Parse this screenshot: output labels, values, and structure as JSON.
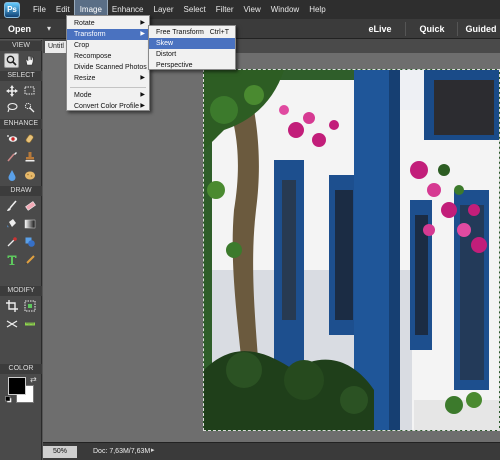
{
  "menubar": {
    "logo": "Ps",
    "items": [
      "File",
      "Edit",
      "Image",
      "Enhance",
      "Layer",
      "Select",
      "Filter",
      "View",
      "Window",
      "Help"
    ],
    "active": "Image"
  },
  "toolbar": {
    "open_label": "Open",
    "open_arrow": "▾",
    "modes": [
      "eLive",
      "Quick",
      "Guided"
    ]
  },
  "tools_panel": {
    "sections": [
      "VIEW",
      "SELECT",
      "ENHANCE",
      "DRAW",
      "MODIFY",
      "COLOR"
    ]
  },
  "document": {
    "tab_label": "Untitl"
  },
  "status": {
    "zoom": "50%",
    "doc_size": "Doc: 7,63M/7,63M",
    "arrow": "▸"
  },
  "image_menu": {
    "items": [
      "Rotate",
      "Transform",
      "Crop",
      "Recompose",
      "Divide Scanned Photos",
      "Resize",
      "Mode",
      "Convert Color Profile"
    ],
    "highlighted": "Transform"
  },
  "transform_menu": {
    "items": [
      "Free Transform",
      "Skew",
      "Distort",
      "Perspective"
    ],
    "free_transform_shortcut": "Ctrl+T",
    "highlighted": "Skew"
  },
  "colors": {
    "accent_blue": "#4a72c0",
    "menubar": "#2e2e2e",
    "panel": "#4a4a4a",
    "canvas_bg": "#6e6e6e"
  }
}
